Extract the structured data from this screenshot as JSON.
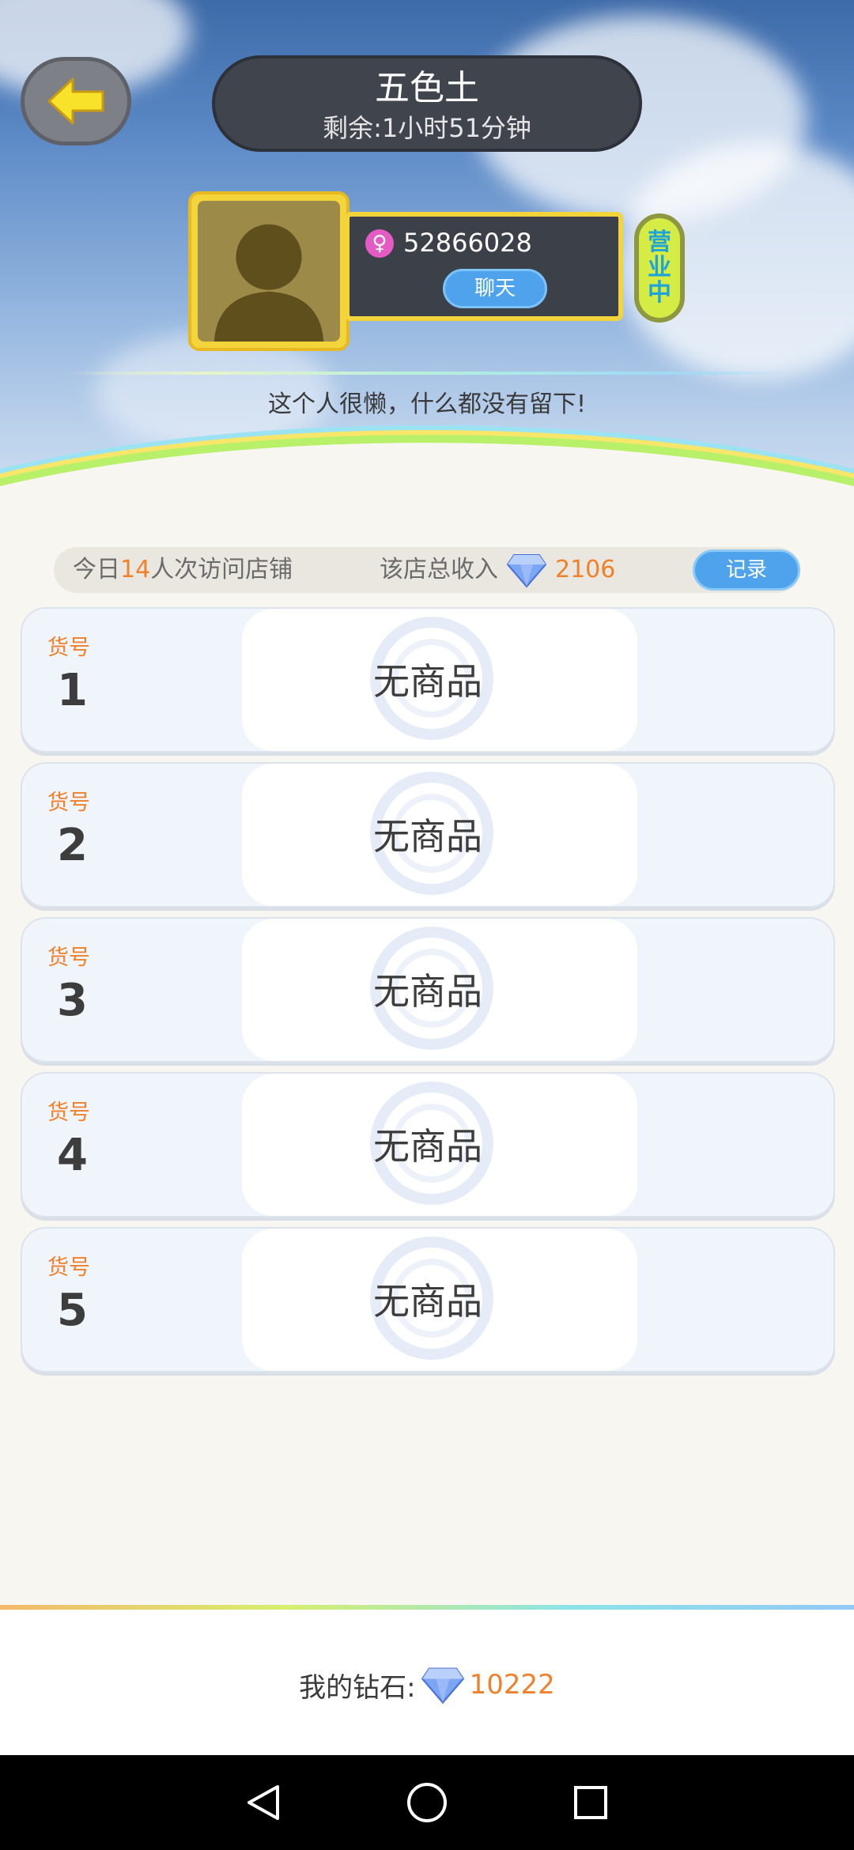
{
  "header": {
    "shop_name": "五色土",
    "remaining_time": "剩余:1小时51分钟"
  },
  "profile": {
    "gender_icon": "female-icon",
    "user_id": "52866028",
    "chat_label": "聊天",
    "status_chars": [
      "营",
      "业",
      "中"
    ],
    "bio": "这个人很懒，什么都没有留下!"
  },
  "stats": {
    "visits_prefix": "今日",
    "visits_count": "14",
    "visits_suffix": "人次访问店铺",
    "income_label": "该店总收入",
    "income_value": "2106",
    "record_label": "记录"
  },
  "slots": [
    {
      "code_label": "货号",
      "number": "1",
      "content": "无商品"
    },
    {
      "code_label": "货号",
      "number": "2",
      "content": "无商品"
    },
    {
      "code_label": "货号",
      "number": "3",
      "content": "无商品"
    },
    {
      "code_label": "货号",
      "number": "4",
      "content": "无商品"
    },
    {
      "code_label": "货号",
      "number": "5",
      "content": "无商品"
    }
  ],
  "footer": {
    "my_diamonds_label": "我的钻石:",
    "my_diamonds_value": "10222"
  },
  "colors": {
    "accent_orange": "#f0812a",
    "button_blue": "#4ea3ec",
    "frame_yellow": "#f3d43a"
  }
}
